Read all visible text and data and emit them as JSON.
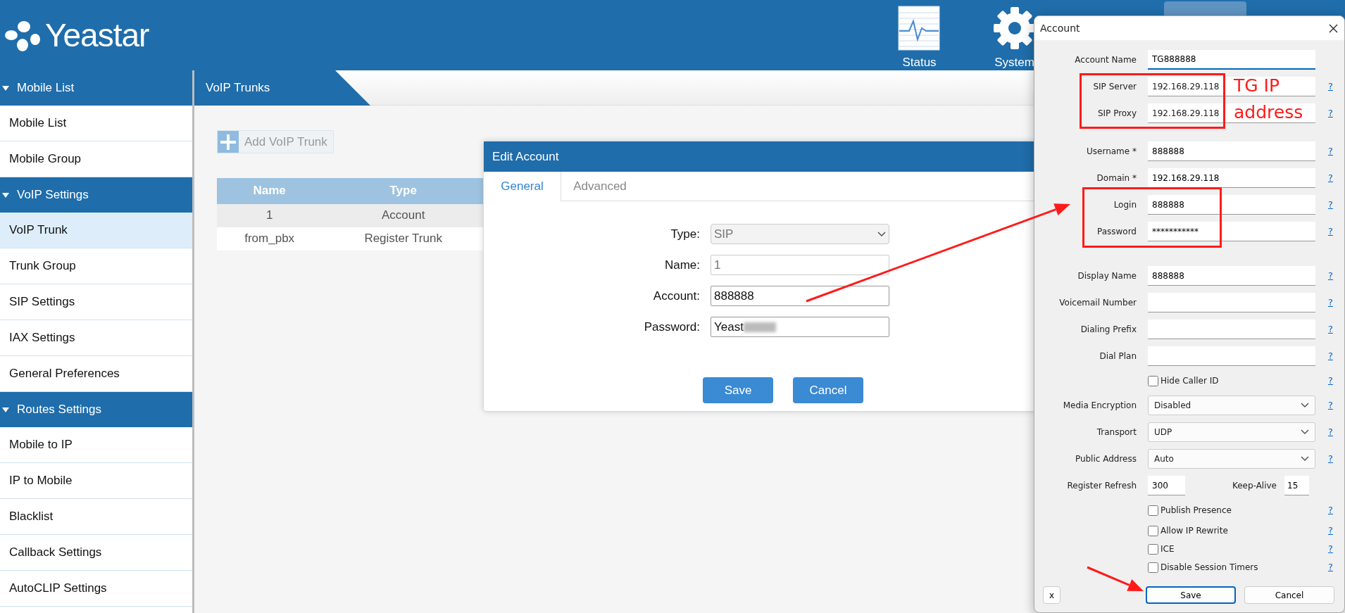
{
  "header": {
    "logo": "Yeastar",
    "nav": [
      {
        "label": "Status"
      },
      {
        "label": "System"
      }
    ]
  },
  "sidebar": {
    "groups": [
      {
        "title": "Mobile List",
        "expanded": true,
        "items": [
          {
            "label": "Mobile List",
            "selected": false
          },
          {
            "label": "Mobile Group",
            "selected": false
          }
        ]
      },
      {
        "title": "VoIP Settings",
        "expanded": true,
        "items": [
          {
            "label": "VoIP Trunk",
            "selected": true
          },
          {
            "label": "Trunk Group",
            "selected": false
          },
          {
            "label": "SIP Settings",
            "selected": false
          },
          {
            "label": "IAX Settings",
            "selected": false
          },
          {
            "label": "General Preferences",
            "selected": false
          }
        ]
      },
      {
        "title": "Routes Settings",
        "expanded": true,
        "items": [
          {
            "label": "Mobile to IP",
            "selected": false
          },
          {
            "label": "IP to Mobile",
            "selected": false
          },
          {
            "label": "Blacklist",
            "selected": false
          },
          {
            "label": "Callback Settings",
            "selected": false
          },
          {
            "label": "AutoCLIP Settings",
            "selected": false
          }
        ]
      }
    ]
  },
  "page_tab": "VoIP Trunks",
  "add_button": "Add VoIP Trunk",
  "table": {
    "columns": [
      "Name",
      "Type"
    ],
    "rows": [
      [
        "1",
        "Account"
      ],
      [
        "from_pbx",
        "Register Trunk"
      ]
    ]
  },
  "edit_dialog": {
    "title": "Edit Account",
    "tabs": [
      {
        "label": "General",
        "selected": true
      },
      {
        "label": "Advanced",
        "selected": false
      }
    ],
    "fields": [
      {
        "label": "Type:",
        "kind": "select",
        "value": "SIP",
        "disabled": true
      },
      {
        "label": "Name:",
        "kind": "text",
        "value": "1",
        "disabled": true
      },
      {
        "label": "Account:",
        "kind": "text",
        "value": "888888",
        "disabled": false
      },
      {
        "label": "Password:",
        "kind": "redacted",
        "value": "Yeast",
        "disabled": false
      }
    ],
    "buttons": [
      "Save",
      "Cancel"
    ]
  },
  "account_dialog": {
    "title": "Account",
    "rows": [
      {
        "kind": "text",
        "label": "Account Name",
        "value": "TG888888",
        "focused": true
      },
      {
        "kind": "text",
        "label": "SIP Server",
        "value": "192.168.29.118",
        "note": "TG IP",
        "help": "?"
      },
      {
        "kind": "text",
        "label": "SIP Proxy",
        "value": "192.168.29.118",
        "note": "address",
        "help": "?"
      },
      {
        "kind": "text",
        "label": "Username *",
        "value": "888888",
        "help": "?"
      },
      {
        "kind": "text",
        "label": "Domain *",
        "value": "192.168.29.118",
        "help": "?"
      },
      {
        "kind": "text",
        "label": "Login",
        "value": "888888",
        "help": "?"
      },
      {
        "kind": "text",
        "label": "Password",
        "value": "***********",
        "help": "?"
      },
      {
        "kind": "text",
        "label": "Display Name",
        "value": "888888",
        "help": "?"
      },
      {
        "kind": "text",
        "label": "Voicemail Number",
        "help": "?"
      },
      {
        "kind": "text",
        "label": "Dialing Prefix",
        "help": "?"
      },
      {
        "kind": "text",
        "label": "Dial Plan",
        "help": "?"
      },
      {
        "kind": "checkbox",
        "label": "Hide Caller ID",
        "checked": false,
        "help": "?"
      },
      {
        "kind": "select",
        "label": "Media Encryption",
        "value": "Disabled",
        "help": "?"
      },
      {
        "kind": "select",
        "label": "Transport",
        "value": "UDP",
        "help": "?"
      },
      {
        "kind": "select",
        "label": "Public Address",
        "value": "Auto",
        "help": "?"
      },
      {
        "kind": "pair",
        "label": "Register Refresh",
        "value": "300",
        "label2": "Keep-Alive",
        "value2": "15"
      },
      {
        "kind": "checkbox",
        "label": "Publish Presence",
        "checked": false,
        "help": "?"
      },
      {
        "kind": "checkbox",
        "label": "Allow IP Rewrite",
        "checked": false,
        "help": "?"
      },
      {
        "kind": "checkbox",
        "label": "ICE",
        "checked": false,
        "help": "?"
      },
      {
        "kind": "checkbox",
        "label": "Disable Session Timers",
        "checked": false,
        "help": "?"
      }
    ],
    "buttons": [
      {
        "label": "x",
        "focused": false
      },
      {
        "label": "Save",
        "focused": true
      },
      {
        "label": "Cancel",
        "focused": false
      }
    ]
  }
}
